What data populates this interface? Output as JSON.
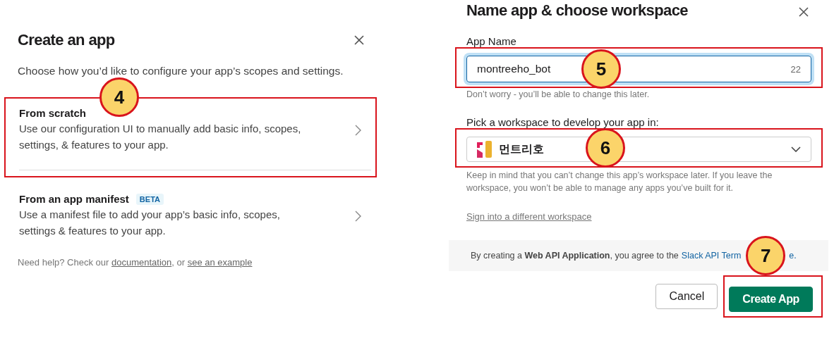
{
  "create_app": {
    "title": "Create an app",
    "subtitle": "Choose how you’d like to configure your app’s scopes and settings.",
    "options": [
      {
        "title": "From scratch",
        "description": "Use our configuration UI to manually add basic info, scopes, settings, & features to your app.",
        "highlighted": true,
        "step": "4"
      },
      {
        "title": "From an app manifest",
        "badge": "BETA",
        "description": "Use a manifest file to add your app’s basic info, scopes, settings & features to your app.",
        "highlighted": false
      }
    ],
    "help": {
      "prefix": "Need help? Check our ",
      "link_1": "documentation",
      "middle": ", or ",
      "link_2": "see an example"
    }
  },
  "name_app": {
    "title": "Name app & choose workspace",
    "app_name": {
      "label": "App Name",
      "value": "montreeho_bot",
      "counter": "22",
      "hint": "Don’t worry - you’ll be able to change this later.",
      "step": "5"
    },
    "workspace": {
      "label": "Pick a workspace to develop your app in:",
      "value": "먼트리호",
      "hint": "Keep in mind that you can’t change this app’s workspace later. If you leave the workspace, you won’t be able to manage any apps you’ve built for it.",
      "step": "6"
    },
    "sign_in_link": "Sign into a different workspace",
    "terms": {
      "text": "By creating a **Web API Application**, you agree to the ",
      "link": "Slack API Term",
      "tail": "e."
    },
    "buttons": [
      {
        "label": "Cancel",
        "kind": "secondary"
      },
      {
        "label": "Create App",
        "kind": "primary",
        "highlighted": true,
        "step": "7"
      }
    ]
  }
}
